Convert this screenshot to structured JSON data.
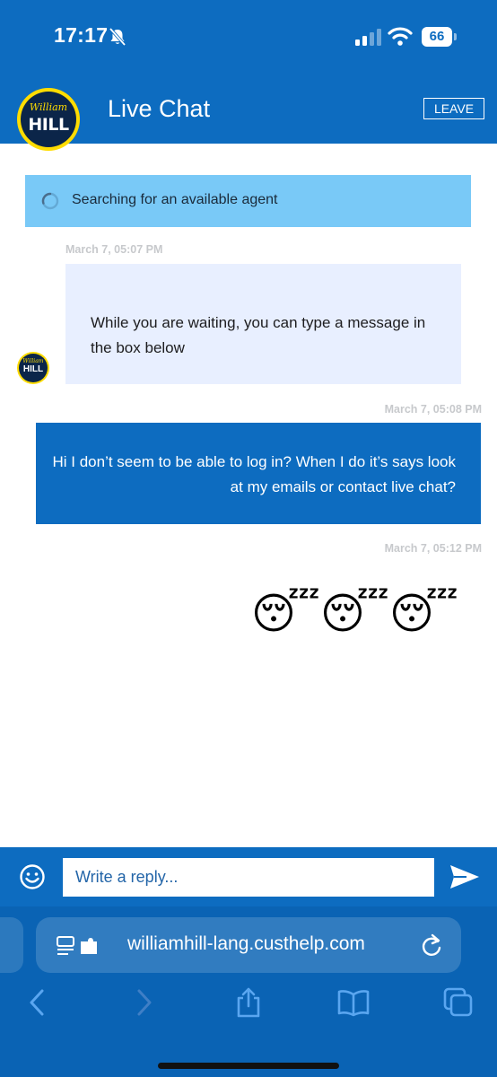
{
  "status_bar": {
    "time": "17:17",
    "battery_level": "66",
    "icons": [
      "silent-bell-icon",
      "signal-icon",
      "wifi-icon",
      "battery-icon"
    ]
  },
  "header": {
    "logo_top": "William",
    "logo_bottom": "HILL",
    "title": "Live Chat",
    "leave_label": "LEAVE"
  },
  "banner": {
    "text": "Searching for an available agent",
    "icon": "spinner-icon"
  },
  "messages": [
    {
      "sender": "agent",
      "timestamp": "March 7, 05:07 PM",
      "text": "While you are waiting, you can type a message in the box below"
    },
    {
      "sender": "user",
      "timestamp": "March 7, 05:08 PM",
      "text": "Hi I don’t seem to be able to log in? When I do it’s says look at my emails or contact live chat?"
    },
    {
      "sender": "user",
      "timestamp": "March 7, 05:12 PM",
      "text": "😴😴😴"
    }
  ],
  "reply": {
    "placeholder": "Write a reply...",
    "value": "",
    "emoji_icon": "smiley-icon",
    "send_icon": "send-icon"
  },
  "browser": {
    "url": "williamhill-lang.custhelp.com",
    "icons": [
      "page-menu-icon",
      "reload-icon",
      "back-icon",
      "forward-icon",
      "share-icon",
      "bookmarks-icon",
      "tabs-icon"
    ]
  },
  "colors": {
    "brand_blue": "#0d6cc0",
    "banner_blue": "#79c9f7",
    "agent_bubble": "#e8efff",
    "logo_yellow": "#ffdc00",
    "logo_navy": "#0b2549"
  }
}
